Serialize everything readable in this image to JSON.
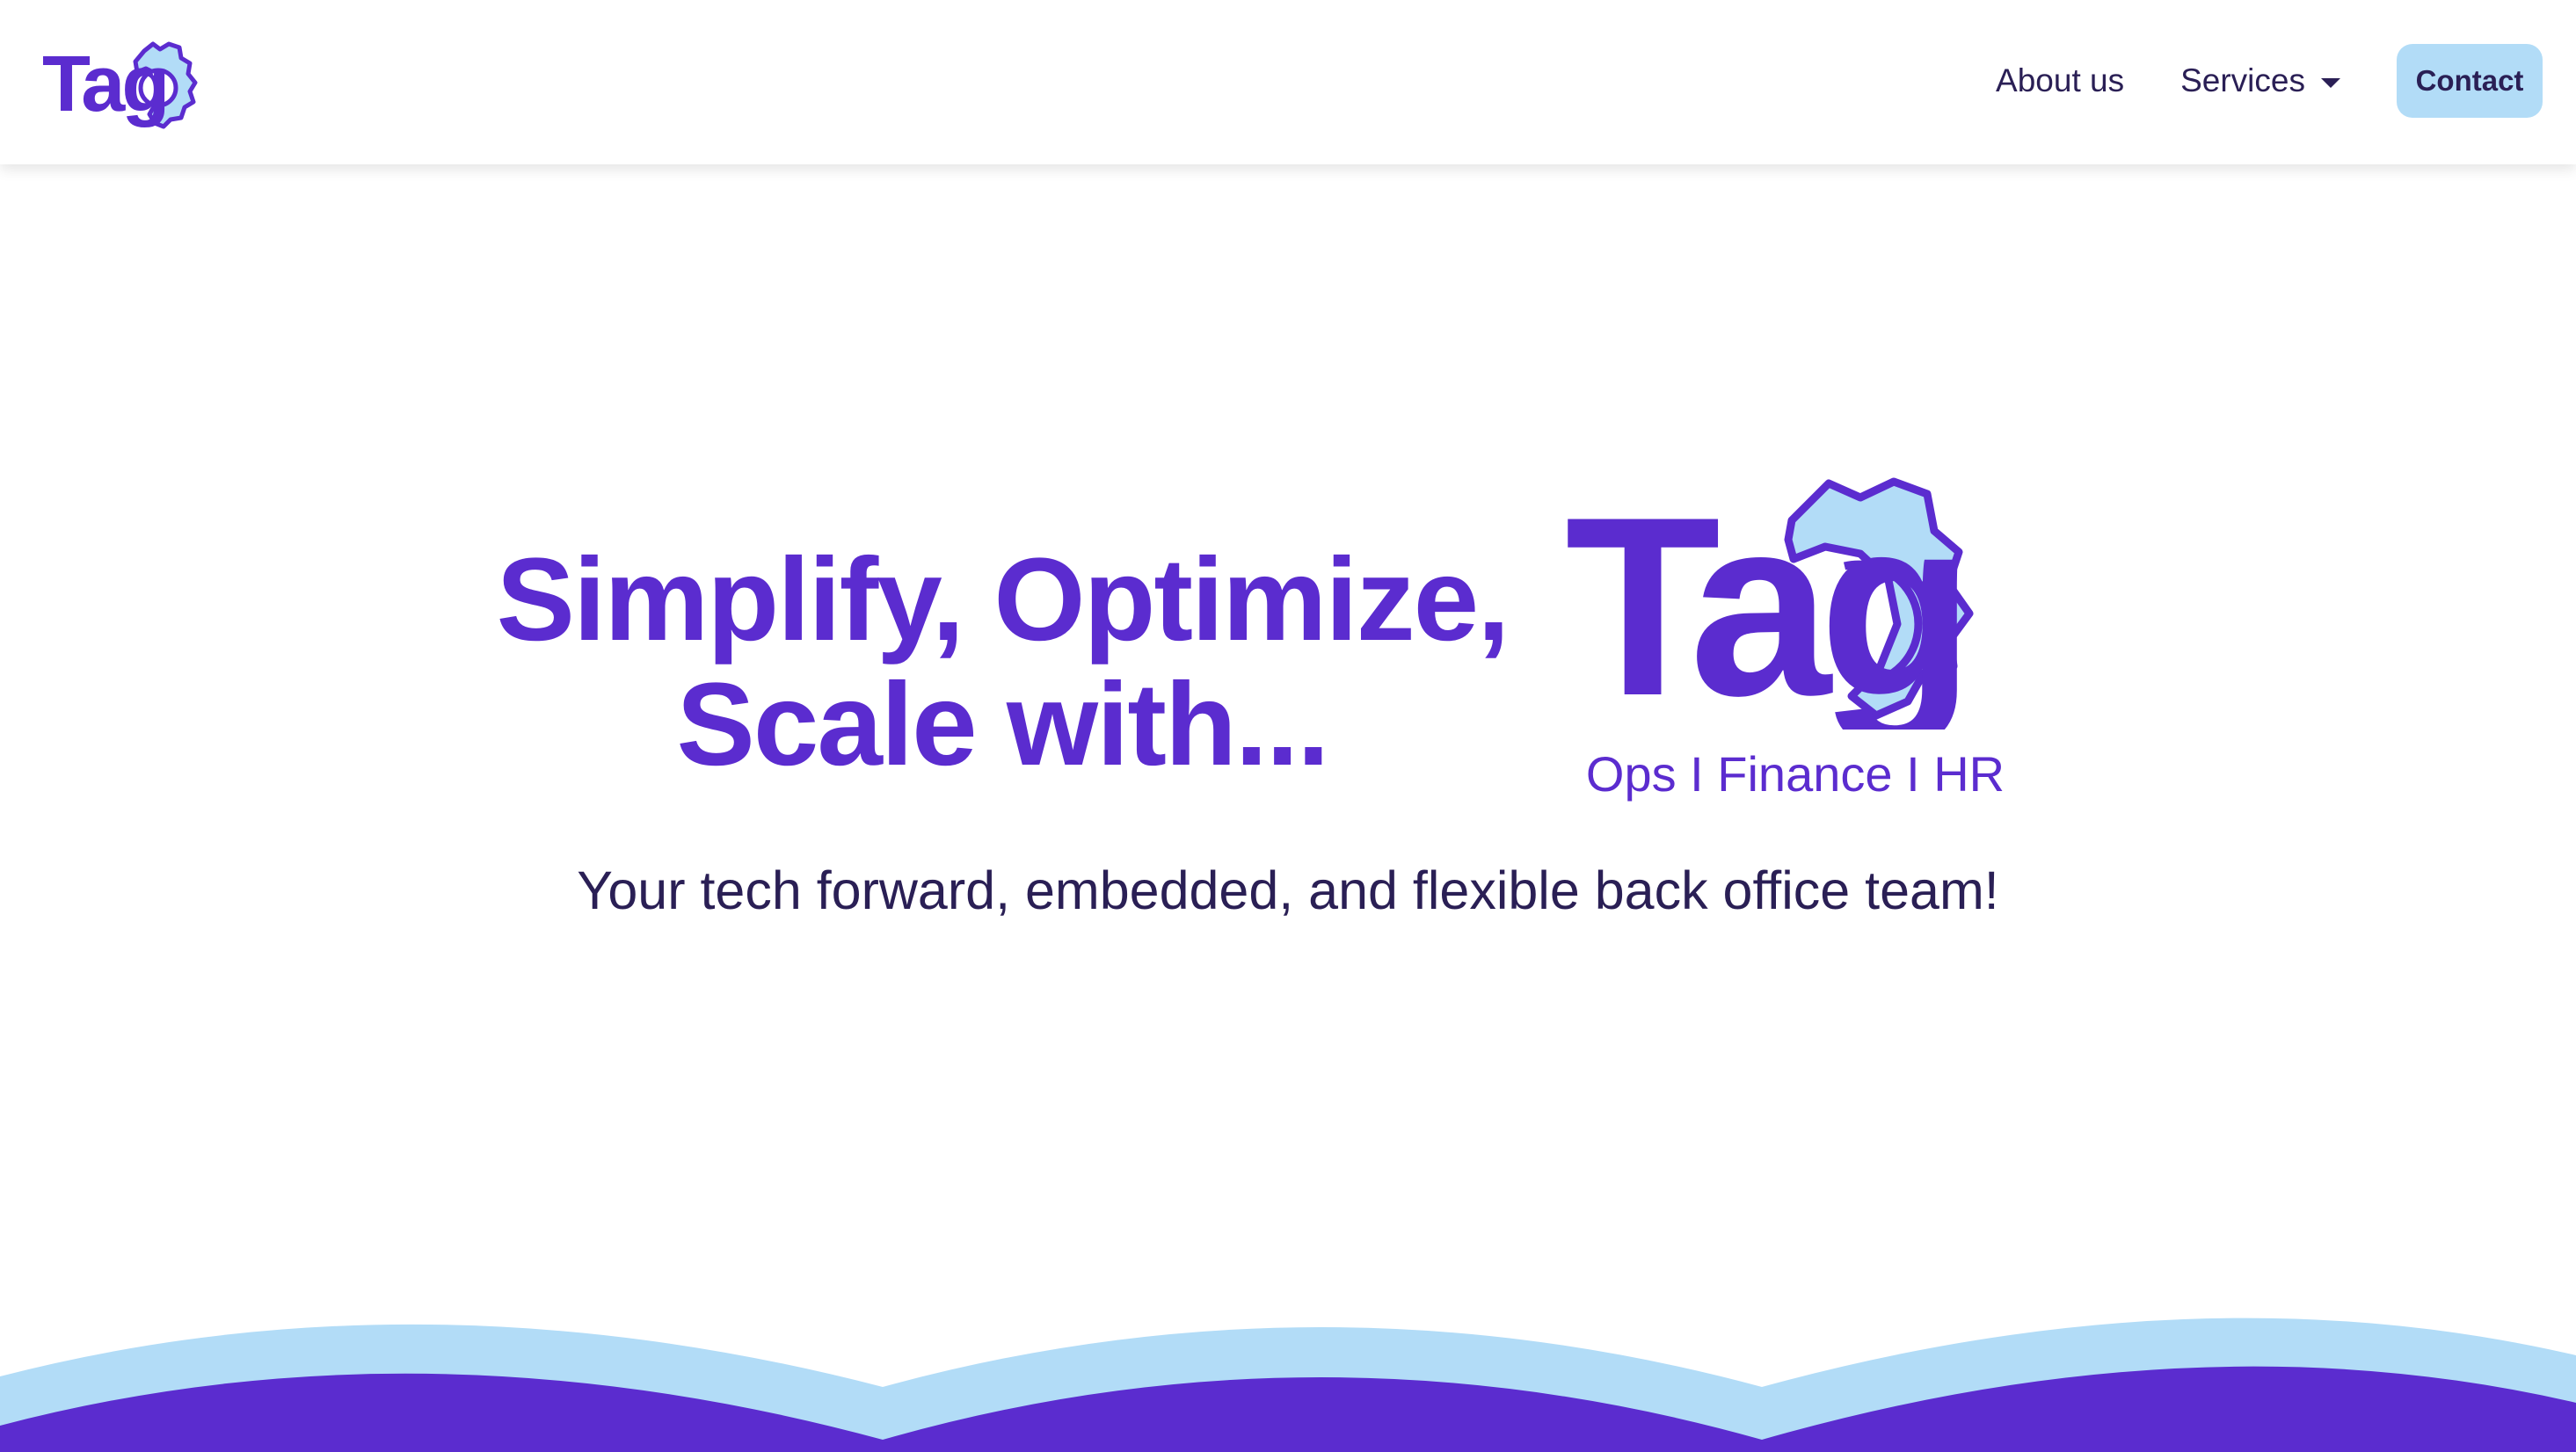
{
  "header": {
    "logo_text": "Tag",
    "nav": {
      "about_label": "About us",
      "services_label": "Services",
      "contact_label": "Contact"
    }
  },
  "hero": {
    "headline_line1": "Simplify, Optimize,",
    "headline_line2": "Scale with...",
    "logo_text": "Tag",
    "logo_tagline": "Ops I Finance I HR",
    "subtitle": "Your tech forward, embedded, and flexible back office team!"
  },
  "colors": {
    "brand_purple": "#5b2ccf",
    "light_blue": "#b2dcf7",
    "dark_text": "#2a1f55"
  },
  "icons": {
    "gear": "gear-icon",
    "dropdown": "chevron-down-icon"
  }
}
